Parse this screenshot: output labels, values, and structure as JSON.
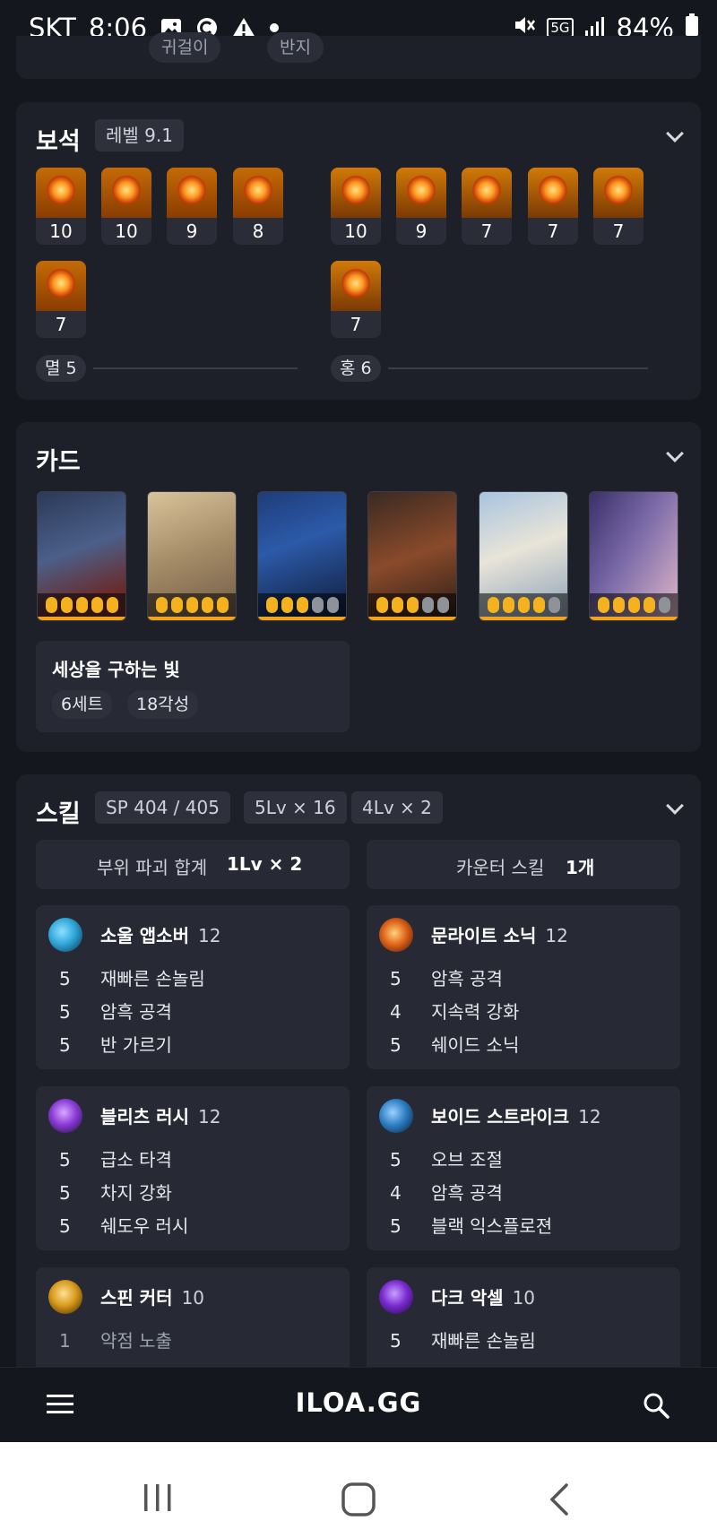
{
  "status_bar": {
    "carrier": "SKT",
    "time": "8:06",
    "network": "5G",
    "battery": "84%"
  },
  "prev_section": {
    "left_chip": "귀걸이",
    "right_chip": "반지"
  },
  "gems": {
    "title": "보석",
    "level_tag": "레벨 9.1",
    "row1_left": [
      "10",
      "10",
      "9",
      "8"
    ],
    "row1_right": [
      "10",
      "9",
      "7",
      "7",
      "7"
    ],
    "row2_left": [
      "7"
    ],
    "row2_right": [
      "7"
    ],
    "summary_left": "멸 5",
    "summary_right": "홍 6"
  },
  "cards": {
    "title": "카드",
    "items": [
      {
        "awakening": 5
      },
      {
        "awakening": 5
      },
      {
        "awakening": 3
      },
      {
        "awakening": 3
      },
      {
        "awakening": 4
      },
      {
        "awakening": 4
      }
    ],
    "set_name": "세상을 구하는 빛",
    "set_count": "6세트",
    "awakening_total": "18각성"
  },
  "skills": {
    "title": "스킬",
    "tags": [
      "SP 404 / 405",
      "5Lv × 16",
      "4Lv × 2"
    ],
    "destroy_label": "부위 파괴 합계",
    "destroy_value": "1Lv × 2",
    "counter_label": "카운터 스킬",
    "counter_value": "1개",
    "list": [
      {
        "name": "소울 앱소버",
        "level": "12",
        "tripods": [
          [
            "5",
            "재빠른 손놀림"
          ],
          [
            "5",
            "암흑 공격"
          ],
          [
            "5",
            "반 가르기"
          ]
        ],
        "color": "#2fa6d8"
      },
      {
        "name": "문라이트 소닉",
        "level": "12",
        "tripods": [
          [
            "5",
            "암흑 공격"
          ],
          [
            "4",
            "지속력 강화"
          ],
          [
            "5",
            "쉐이드 소닉"
          ]
        ],
        "color": "#e0621a"
      },
      {
        "name": "블리츠 러시",
        "level": "12",
        "tripods": [
          [
            "5",
            "급소 타격"
          ],
          [
            "5",
            "차지 강화"
          ],
          [
            "5",
            "쉐도우 러시"
          ]
        ],
        "color": "#8a3cd6"
      },
      {
        "name": "보이드 스트라이크",
        "level": "12",
        "tripods": [
          [
            "5",
            "오브 조절"
          ],
          [
            "4",
            "암흑 공격"
          ],
          [
            "5",
            "블랙 익스플로젼"
          ]
        ],
        "color": "#2d7fc4"
      },
      {
        "name": "스핀 커터",
        "level": "10",
        "tripods": [
          [
            "1",
            "약점 노출"
          ]
        ],
        "color": "#d69a1a"
      },
      {
        "name": "다크 악셀",
        "level": "10",
        "tripods": [
          [
            "5",
            "재빠른 손놀림"
          ]
        ],
        "color": "#7a2bd0"
      }
    ]
  },
  "bottom_bar": {
    "logo": "ILOA.GG"
  }
}
